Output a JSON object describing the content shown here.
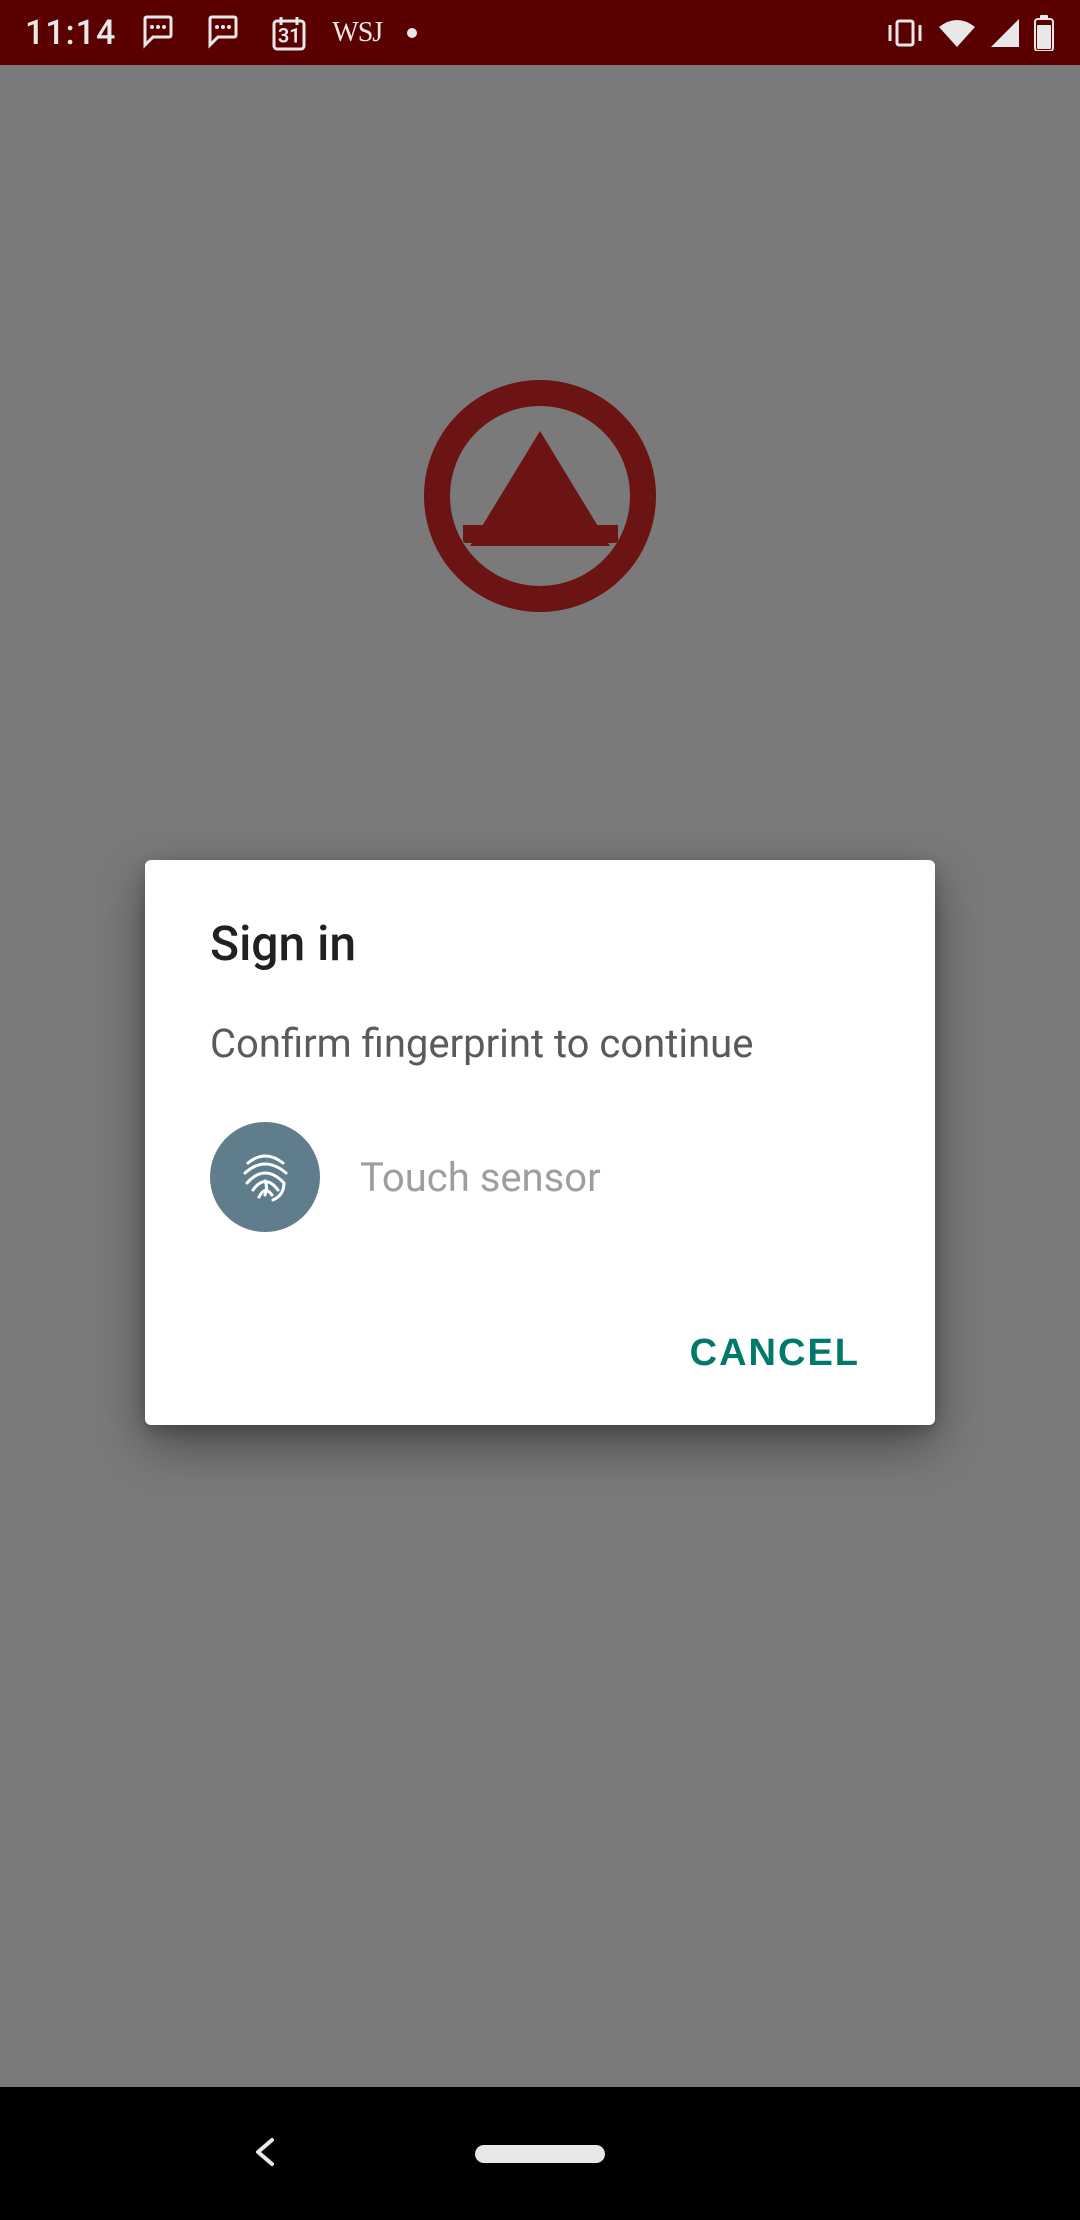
{
  "status_bar": {
    "time": "11:14",
    "calendar_day": "31",
    "wsj_label": "WSJ"
  },
  "dialog": {
    "title": "Sign in",
    "subtitle": "Confirm fingerprint to continue",
    "touch_sensor": "Touch sensor",
    "cancel_label": "CANCEL"
  },
  "colors": {
    "status_bar_bg": "#5a0000",
    "logo_color": "#6c1313",
    "accent": "#00796b",
    "fingerprint_bg": "#607d8b"
  }
}
